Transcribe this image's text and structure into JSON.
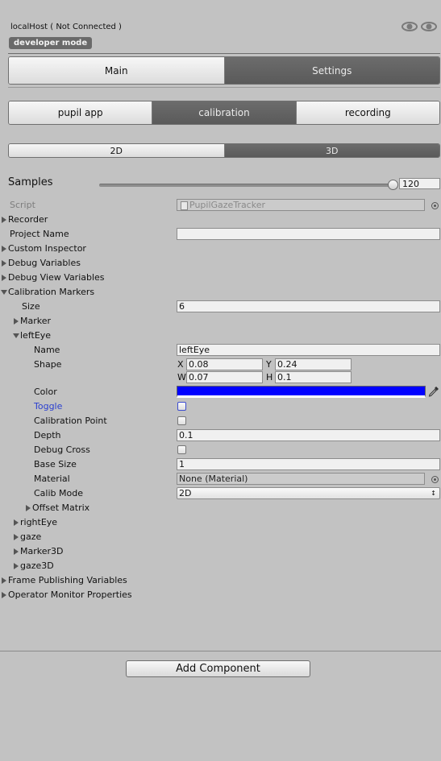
{
  "header": {
    "title": "localHost ( Not Connected )",
    "badge": "developer mode"
  },
  "tabs_main": {
    "items": [
      "Main",
      "Settings"
    ],
    "selected": "Settings"
  },
  "tabs_settings": {
    "items": [
      "pupil app",
      "calibration",
      "recording"
    ],
    "selected": "calibration"
  },
  "tabs_mode": {
    "items": [
      "2D",
      "3D"
    ],
    "selected": "3D"
  },
  "samples": {
    "label": "Samples",
    "value": "120",
    "slider_fraction": 0.98
  },
  "inspector": {
    "script_label": "Script",
    "script_value": "PupilGazeTracker",
    "recorder": "Recorder",
    "project_name_label": "Project Name",
    "project_name_value": "",
    "custom_inspector": "Custom Inspector",
    "debug_variables": "Debug Variables",
    "debug_view_variables": "Debug View Variables",
    "calibration_markers": "Calibration Markers",
    "size_label": "Size",
    "size_value": "6",
    "marker": "Marker",
    "left_eye": "leftEye",
    "name_label": "Name",
    "name_value": "leftEye",
    "shape_label": "Shape",
    "shape": {
      "x_label": "X",
      "x": "0.08",
      "y_label": "Y",
      "y": "0.24",
      "w_label": "W",
      "w": "0.07",
      "h_label": "H",
      "h": "0.1"
    },
    "color_label": "Color",
    "color_value": "#0000ff",
    "toggle_label": "Toggle",
    "calibration_point_label": "Calibration Point",
    "depth_label": "Depth",
    "depth_value": "0.1",
    "debug_cross_label": "Debug Cross",
    "base_size_label": "Base Size",
    "base_size_value": "1",
    "material_label": "Material",
    "material_value": "None (Material)",
    "calib_mode_label": "Calib Mode",
    "calib_mode_value": "2D",
    "offset_matrix": "Offset Matrix",
    "right_eye": "rightEye",
    "gaze": "gaze",
    "marker3d": "Marker3D",
    "gaze3d": "gaze3D",
    "frame_publishing": "Frame Publishing Variables",
    "operator_monitor": "Operator Monitor Properties"
  },
  "footer": {
    "add_component": "Add Component"
  },
  "colors": {
    "background": "#c2c2c2",
    "selected_tab": "#5f5f5f",
    "toggle_label": "#2a3fd0"
  }
}
